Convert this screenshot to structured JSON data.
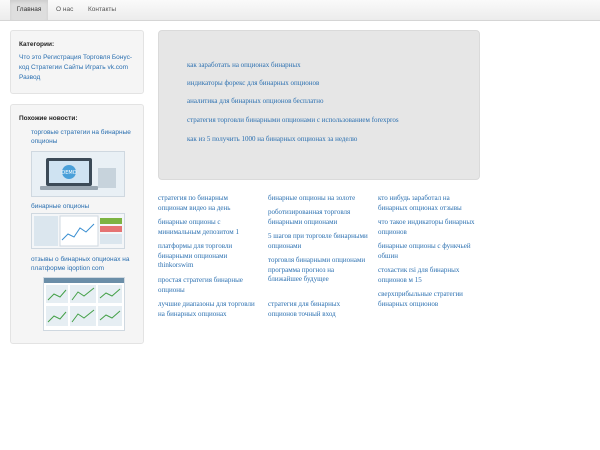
{
  "nav": {
    "items": [
      {
        "label": "Главная",
        "active": true
      },
      {
        "label": "О нас",
        "active": false
      },
      {
        "label": "Контакты",
        "active": false
      }
    ]
  },
  "sidebar": {
    "categories_title": "Категории:",
    "categories_text": "Что это Регистрация Торговля Бонус-код Стратегии Сайты Играть vk.com Развод",
    "news_title": "Похожие новости:",
    "news": [
      {
        "label": "торговые стратегии на бинарные опционы",
        "thumb": "demo-laptop-image"
      },
      {
        "label": "бинарные опционы",
        "thumb": "trading-screenshot-image"
      },
      {
        "label": "отзывы о бинарных опционах на платформе iqoption com",
        "thumb": "platform-screenshot-image"
      }
    ]
  },
  "hero": {
    "links": [
      "как заработать на опционах бинарных",
      "индикаторы форекс для бинарных опционов",
      "аналитика для бинарных опционов бесплатно",
      "стратегия торговли бинарными опционами с использованием forexpros",
      "как из 5 получить 1000 на бинарных опционах за неделю"
    ]
  },
  "columns": [
    [
      "стратегия по бинарным опционам видео на день",
      "бинарные опционы с минимальным депозитом 1",
      "платформы для торговли бинарными опционами thinkorswim",
      "простая стратегия бинарные опционы",
      "лучшие диапазоны для торговли на бинарных опционах"
    ],
    [
      "бинарные опционы на золоте",
      "роботизированная торговля бинарными опционами",
      "5 шагов при торговле бинарными опционами",
      "торговля бинарными опционами программа прогноз на ближайшее будущее",
      "стратегия для бинарных опционов точный вход"
    ],
    [
      "кто нибудь заработал на бинарных опционах отзывы",
      "что такое индикаторы бинарных опционов",
      "бинарные опционы с функчьей обшин",
      "стохастик rsi для бинарных опционов м 15",
      "сверхприбыльные стратегии бинарных опционов"
    ]
  ],
  "colors": {
    "link": "#2a6fb0",
    "well": "#f5f5f5",
    "hero": "#e6e6e6"
  }
}
